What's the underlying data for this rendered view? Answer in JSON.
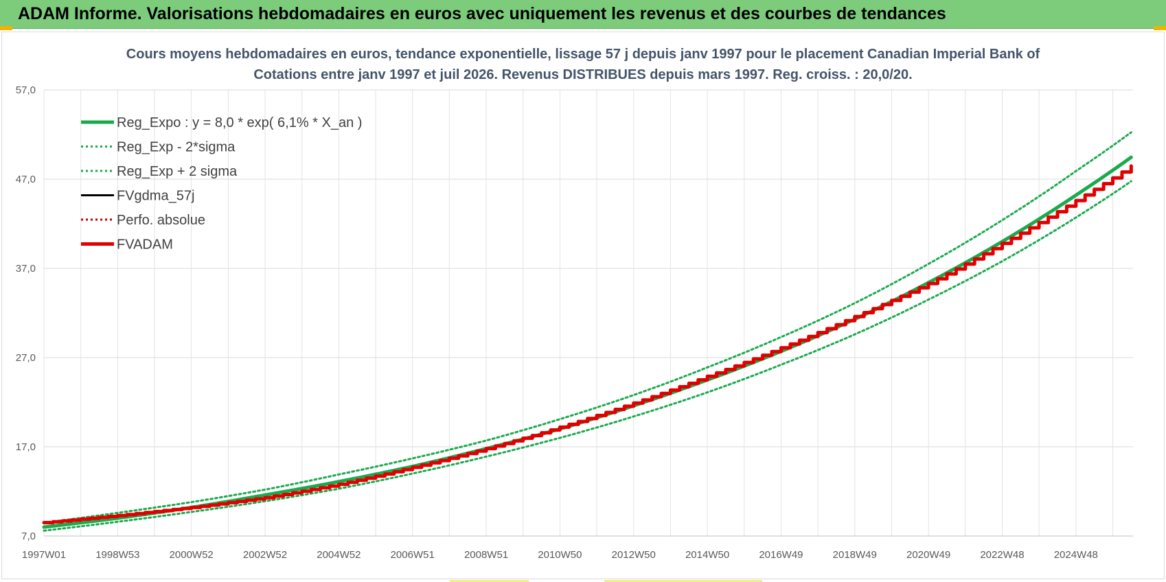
{
  "header": {
    "title": "ADAM Informe. Valorisations hebdomadaires en euros avec uniquement les revenus et des courbes de tendances",
    "background_color": "#7ccc7c"
  },
  "chart_data": {
    "type": "line",
    "title_line1": "Cours moyens hebdomadaires en euros, tendance exponentielle, lissage 57 j depuis janv 1997 pour le placement Canadian Imperial Bank of",
    "title_line2": "Cotations entre janv 1997 et juil 2026. Revenus DISTRIBUES depuis mars 1997. Reg. croiss. : 20,0/20.",
    "xlabel": "",
    "ylabel": "",
    "ylim": [
      7,
      57
    ],
    "yticks": [
      "7,0",
      "17,0",
      "27,0",
      "37,0",
      "47,0",
      "57,0"
    ],
    "xlim": [
      1997.0,
      2026.55
    ],
    "xticks": [
      {
        "x": 1997.0,
        "label": "1997W01"
      },
      {
        "x": 1999.0,
        "label": "1998W53"
      },
      {
        "x": 2001.0,
        "label": "2000W52"
      },
      {
        "x": 2003.0,
        "label": "2002W52"
      },
      {
        "x": 2005.0,
        "label": "2004W52"
      },
      {
        "x": 2007.0,
        "label": "2006W51"
      },
      {
        "x": 2009.0,
        "label": "2008W51"
      },
      {
        "x": 2011.0,
        "label": "2010W50"
      },
      {
        "x": 2013.0,
        "label": "2012W50"
      },
      {
        "x": 2015.0,
        "label": "2014W50"
      },
      {
        "x": 2017.0,
        "label": "2016W49"
      },
      {
        "x": 2019.0,
        "label": "2018W49"
      },
      {
        "x": 2021.0,
        "label": "2020W49"
      },
      {
        "x": 2023.0,
        "label": "2022W48"
      },
      {
        "x": 2025.0,
        "label": "2024W48"
      }
    ],
    "grid": true,
    "legend_position": "top-left",
    "series": [
      {
        "name": "Reg_Expo : y = 8,0 * exp( 6,1% *  X_an )",
        "style": "solid-thick",
        "color": "#1aaa4e",
        "x": [
          1997,
          1999,
          2001,
          2003,
          2005,
          2007,
          2009,
          2011,
          2013,
          2015,
          2017,
          2019,
          2021,
          2023,
          2025,
          2026.55
        ],
        "values": [
          8.0,
          9.0,
          10.2,
          11.6,
          13.1,
          14.8,
          16.8,
          19.0,
          21.6,
          24.5,
          27.7,
          31.3,
          35.4,
          40.0,
          45.2,
          49.6
        ]
      },
      {
        "name": "Reg_Exp - 2*sigma",
        "style": "dotted",
        "color": "#1aaa4e",
        "x": [
          1997,
          1999,
          2001,
          2003,
          2005,
          2007,
          2009,
          2011,
          2013,
          2015,
          2017,
          2019,
          2021,
          2023,
          2025,
          2026.55
        ],
        "values": [
          7.6,
          8.6,
          9.7,
          10.9,
          12.3,
          14.0,
          15.9,
          18.0,
          20.4,
          23.1,
          26.2,
          29.6,
          33.5,
          37.8,
          42.7,
          46.9
        ]
      },
      {
        "name": "Reg_Exp + 2 sigma",
        "style": "dotted",
        "color": "#1aaa4e",
        "x": [
          1997,
          1999,
          2001,
          2003,
          2005,
          2007,
          2009,
          2011,
          2013,
          2015,
          2017,
          2019,
          2021,
          2023,
          2025,
          2026.55
        ],
        "values": [
          8.5,
          9.6,
          10.8,
          12.2,
          13.9,
          15.7,
          17.7,
          20.1,
          22.8,
          25.9,
          29.3,
          33.1,
          37.5,
          42.4,
          47.9,
          52.4
        ]
      },
      {
        "name": "FVgdma_57j",
        "style": "solid",
        "color": "#000000",
        "x": [],
        "values": []
      },
      {
        "name": "Perfo. absolue",
        "style": "dotted",
        "color": "#c00000",
        "x": [],
        "values": []
      },
      {
        "name": "FVADAM",
        "style": "solid-thick-stepped",
        "color": "#e00000",
        "x": [
          1997,
          1999,
          2001,
          2003,
          2005,
          2007,
          2009,
          2011,
          2013,
          2015,
          2017,
          2019,
          2021,
          2023,
          2025,
          2026.55
        ],
        "values": [
          8.5,
          9.3,
          10.2,
          11.3,
          12.8,
          14.7,
          16.8,
          19.2,
          21.9,
          24.9,
          28.1,
          31.6,
          35.3,
          39.8,
          44.6,
          48.6
        ]
      }
    ]
  }
}
